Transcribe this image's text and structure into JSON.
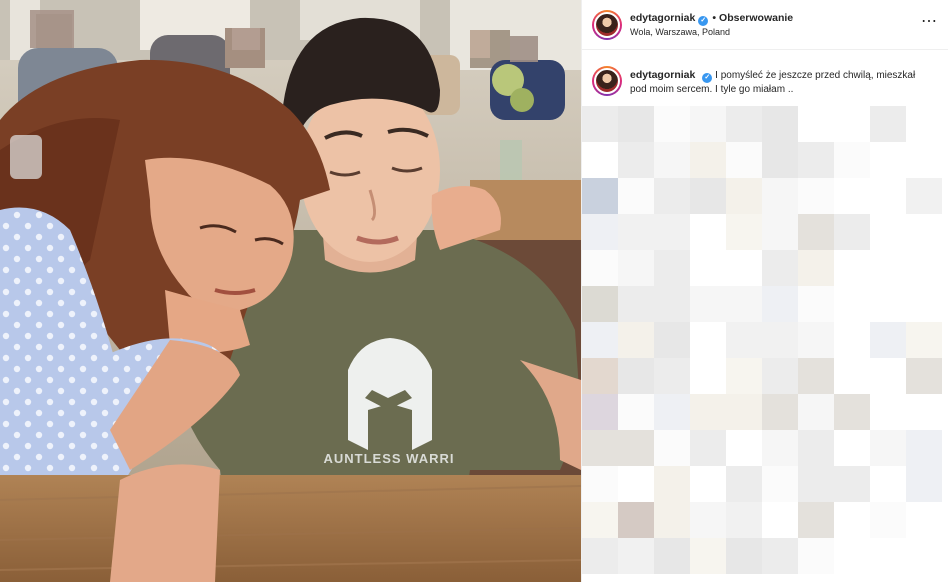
{
  "post": {
    "username": "edytagorniak",
    "verified_mark": "✓",
    "separator": "•",
    "follow_label": "Obserwowanie",
    "location": "Wola, Warszawa, Poland",
    "more_icon": "⋯",
    "caption": "I pomyśleć że jeszcze przed chwilą, mieszkał pod moim sercem. I tyle go miałam .."
  },
  "photo": {
    "shirt_text": "AUNTLESS WARRI"
  },
  "colors": {
    "verified": "#3897f0",
    "text": "#262626",
    "divider": "#efefef"
  }
}
